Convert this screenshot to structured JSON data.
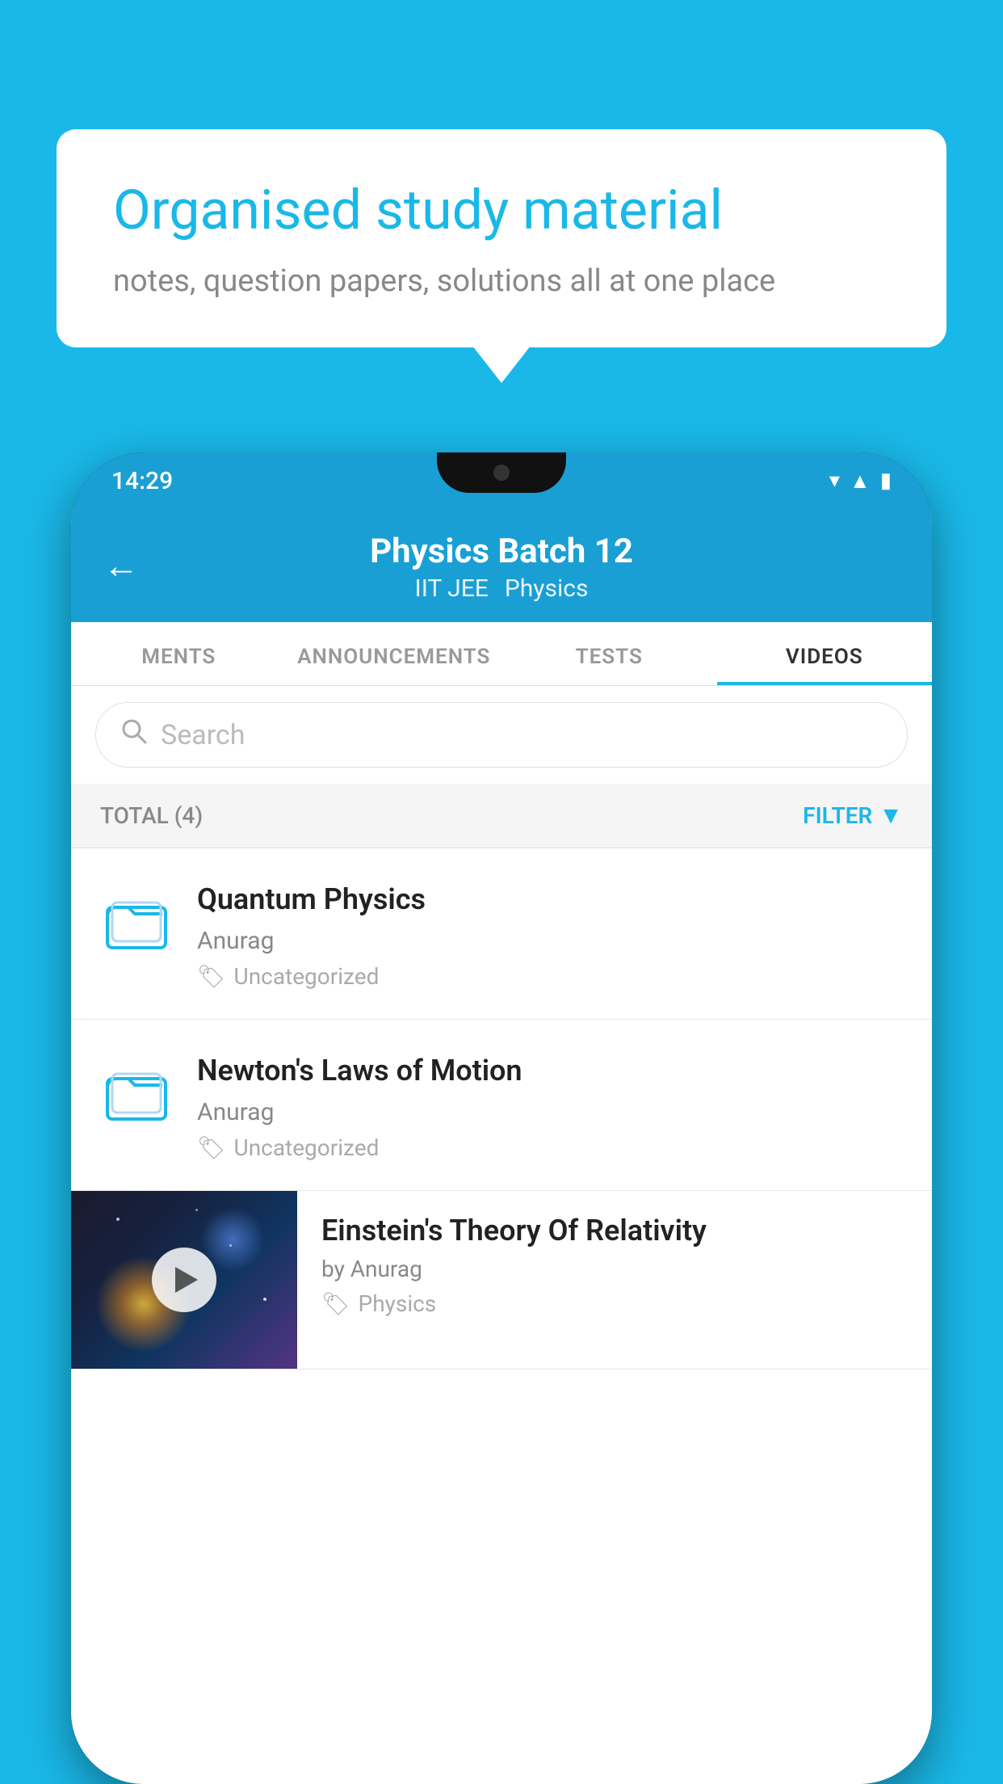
{
  "background_color": "#1ab8e8",
  "bubble": {
    "title": "Organised study material",
    "subtitle": "notes, question papers, solutions all at one place"
  },
  "status_bar": {
    "time": "14:29",
    "icons": [
      "wifi",
      "signal",
      "battery"
    ]
  },
  "header": {
    "title": "Physics Batch 12",
    "subtitle_part1": "IIT JEE",
    "subtitle_part2": "Physics",
    "back_label": "←"
  },
  "tabs": [
    {
      "label": "MENTS",
      "active": false
    },
    {
      "label": "ANNOUNCEMENTS",
      "active": false
    },
    {
      "label": "TESTS",
      "active": false
    },
    {
      "label": "VIDEOS",
      "active": true
    }
  ],
  "search": {
    "placeholder": "Search"
  },
  "filter_bar": {
    "total_label": "TOTAL (4)",
    "filter_label": "FILTER"
  },
  "videos": [
    {
      "title": "Quantum Physics",
      "author": "Anurag",
      "tag": "Uncategorized",
      "has_thumb": false
    },
    {
      "title": "Newton's Laws of Motion",
      "author": "Anurag",
      "tag": "Uncategorized",
      "has_thumb": false
    },
    {
      "title": "Einstein's Theory Of Relativity",
      "author": "by Anurag",
      "tag": "Physics",
      "has_thumb": true
    }
  ]
}
